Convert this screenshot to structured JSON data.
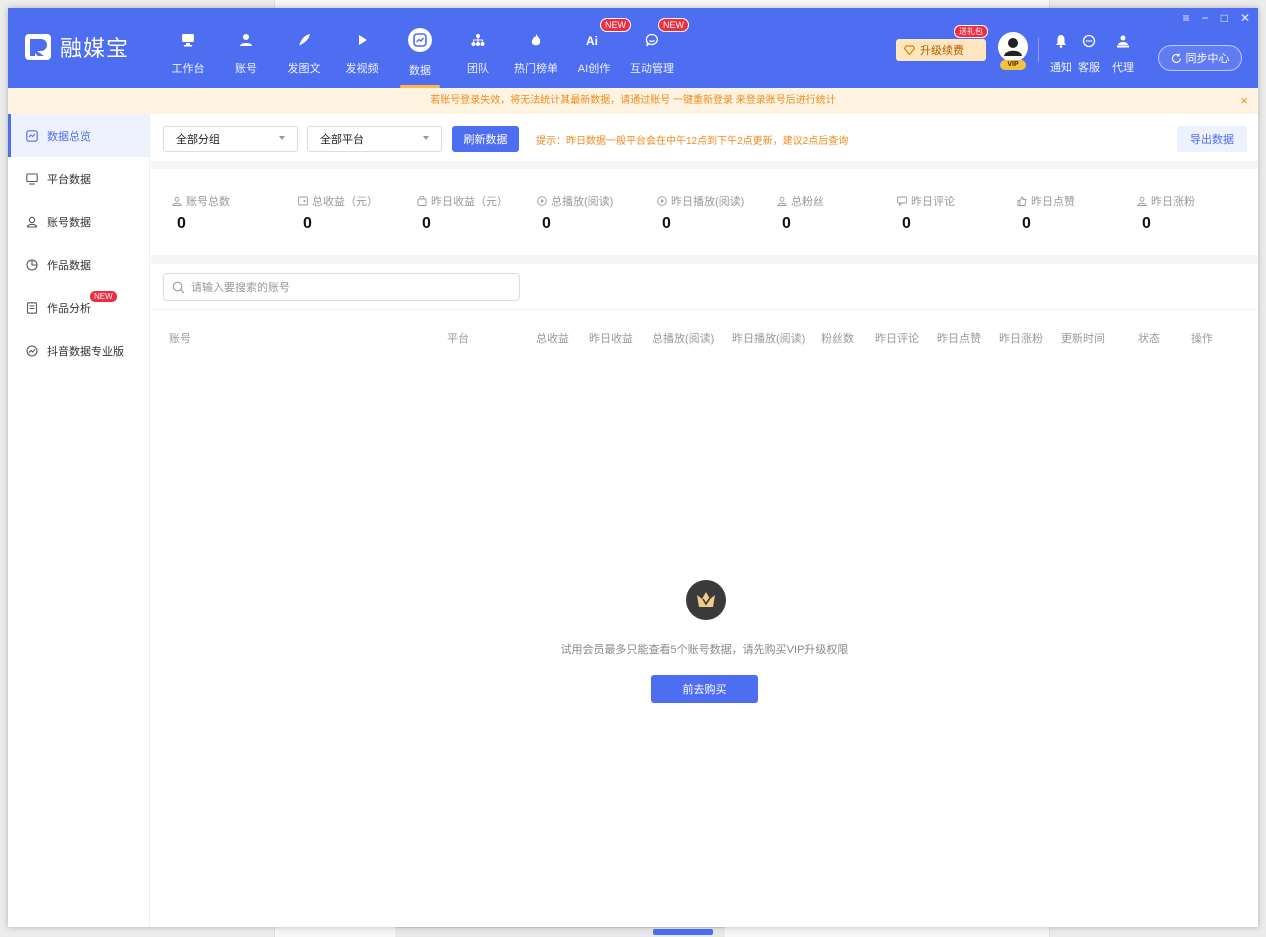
{
  "app": {
    "name": "融媒宝"
  },
  "nav": [
    {
      "label": "工作台",
      "icon": "monitor-icon",
      "badge": ""
    },
    {
      "label": "账号",
      "icon": "user-icon",
      "badge": ""
    },
    {
      "label": "发图文",
      "icon": "feather-icon",
      "badge": ""
    },
    {
      "label": "发视频",
      "icon": "play-icon",
      "badge": ""
    },
    {
      "label": "数据",
      "icon": "chart-icon",
      "badge": "",
      "active": true
    },
    {
      "label": "团队",
      "icon": "team-icon",
      "badge": ""
    },
    {
      "label": "热门榜单",
      "icon": "flame-icon",
      "badge": ""
    },
    {
      "label": "AI创作",
      "icon": "ai-icon",
      "badge": "NEW"
    },
    {
      "label": "互动管理",
      "icon": "chat-icon",
      "badge": "NEW"
    }
  ],
  "header": {
    "upgrade_label": "升级续费",
    "gift_badge": "送礼包",
    "vip_label": "VIP",
    "notify_label": "通知",
    "service_label": "客服",
    "agent_label": "代理",
    "sync_label": "同步中心",
    "win_menu": "≡",
    "win_min": "−",
    "win_max": "□",
    "win_close": "✕"
  },
  "notice": {
    "text": "若账号登录失效，将无法统计其最新数据，请通过账号 一键重新登录 来登录账号后进行统计",
    "close": "×"
  },
  "sidebar": {
    "items": [
      {
        "label": "数据总览",
        "icon": "overview-icon",
        "active": true
      },
      {
        "label": "平台数据",
        "icon": "screen-icon"
      },
      {
        "label": "账号数据",
        "icon": "user-outline-icon"
      },
      {
        "label": "作品数据",
        "icon": "pie-icon"
      },
      {
        "label": "作品分析",
        "icon": "doc-icon",
        "badge": "NEW"
      },
      {
        "label": "抖音数据专业版",
        "icon": "trend-icon"
      }
    ]
  },
  "toolbar": {
    "group_select": "全部分组",
    "platform_select": "全部平台",
    "refresh_label": "刷新数据",
    "tip": "提示：昨日数据一般平台会在中午12点到下午2点更新，建议2点后查询",
    "export_label": "导出数据"
  },
  "stats": [
    {
      "label": "账号总数",
      "value": "0"
    },
    {
      "label": "总收益（元）",
      "value": "0"
    },
    {
      "label": "昨日收益（元）",
      "value": "0"
    },
    {
      "label": "总播放(阅读)",
      "value": "0"
    },
    {
      "label": "昨日播放(阅读)",
      "value": "0"
    },
    {
      "label": "总粉丝",
      "value": "0"
    },
    {
      "label": "昨日评论",
      "value": "0"
    },
    {
      "label": "昨日点赞",
      "value": "0"
    },
    {
      "label": "昨日涨粉",
      "value": "0"
    }
  ],
  "table": {
    "search_placeholder": "请输入要搜索的账号",
    "columns": [
      "账号",
      "平台",
      "总收益",
      "昨日收益",
      "总播放(阅读)",
      "昨日播放(阅读)",
      "粉丝数",
      "昨日评论",
      "昨日点赞",
      "昨日涨粉",
      "更新时间",
      "状态",
      "操作"
    ]
  },
  "empty": {
    "text": "试用会员最多只能查看5个账号数据，请先购买VIP升级权限",
    "button_label": "前去购买"
  }
}
